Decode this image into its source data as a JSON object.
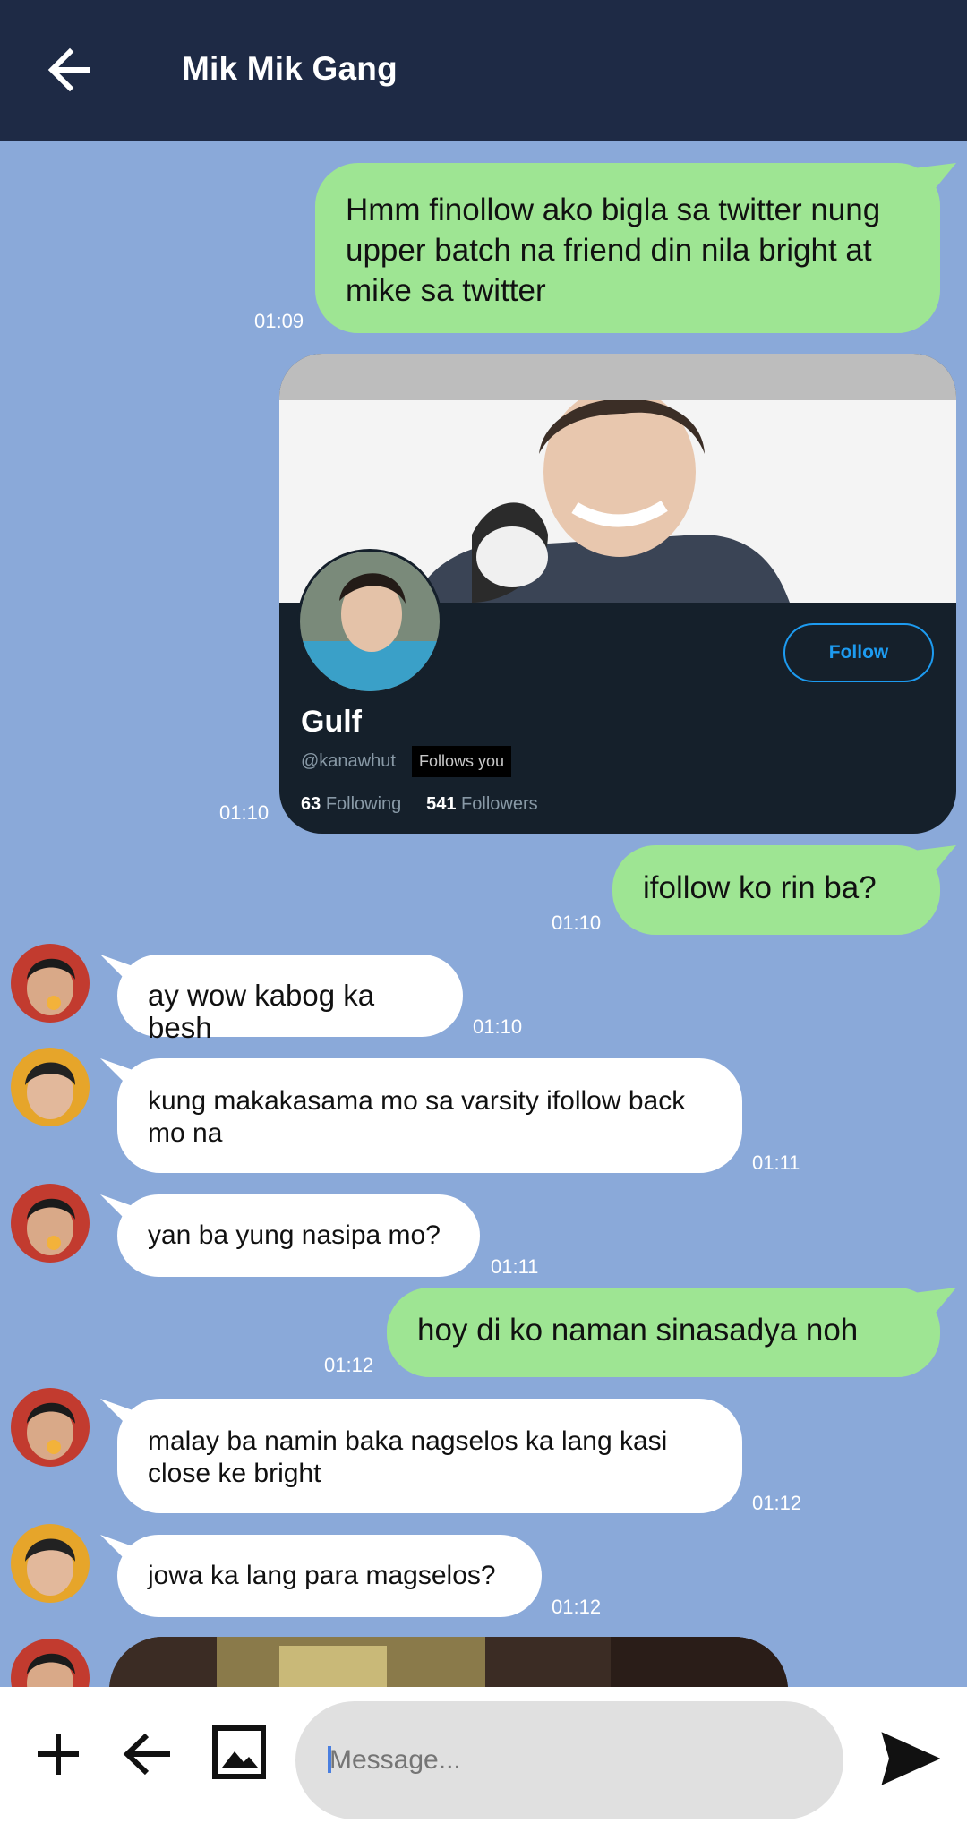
{
  "header": {
    "title": "Mik Mik Gang",
    "back_icon": "arrow-left-icon"
  },
  "messages": [
    {
      "dir": "out",
      "text": "Hmm finollow ako bigla sa twitter nung upper batch na friend din nila bright at mike sa twitter",
      "time": "01:09"
    },
    {
      "dir": "out",
      "type": "profile-card",
      "time": "01:10"
    },
    {
      "dir": "out",
      "text": "ifollow ko rin ba?",
      "time": "01:10"
    },
    {
      "dir": "in",
      "text": "ay wow kabog ka besh",
      "time": "01:10"
    },
    {
      "dir": "in",
      "text": "kung makakasama mo sa varsity ifollow back mo na",
      "time": "01:11"
    },
    {
      "dir": "in",
      "text": "yan ba yung nasipa mo?",
      "time": "01:11"
    },
    {
      "dir": "out",
      "text": "hoy di ko naman sinasadya noh",
      "time": "01:12"
    },
    {
      "dir": "in",
      "text": "malay ba namin baka nagselos ka lang kasi close ke bright",
      "time": "01:12"
    },
    {
      "dir": "in",
      "text": "jowa ka lang para magselos?",
      "time": "01:12"
    }
  ],
  "card": {
    "name": "Gulf",
    "handle": "@kanawhut",
    "follows_you": "Follows you",
    "following_count": "63",
    "following_label": "Following",
    "followers_count": "541",
    "followers_label": "Followers",
    "follow_button": "Follow"
  },
  "composer": {
    "placeholder": "Message...",
    "icons": [
      "plus-icon",
      "arrow-left-icon",
      "image-icon",
      "send-icon"
    ]
  },
  "colors": {
    "header": "#1e2a45",
    "background": "#8aa9d9",
    "outgoing": "#9ee593",
    "incoming": "#ffffff",
    "accent": "#1d9bf0"
  }
}
